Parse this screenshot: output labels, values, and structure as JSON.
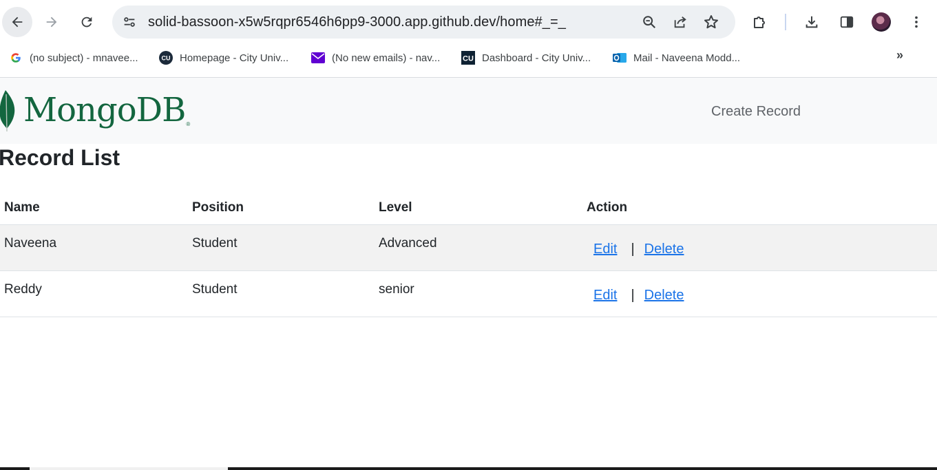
{
  "browser": {
    "url": "solid-bassoon-x5w5rqpr6546h6pp9-3000.app.github.dev/home#_=_",
    "more_bookmarks": "»"
  },
  "bookmarks": [
    {
      "label": "(no subject) - mnavee...",
      "icon": "google-icon"
    },
    {
      "label": "Homepage - City Univ...",
      "icon": "cu-icon"
    },
    {
      "label": "(No new emails) - nav...",
      "icon": "mail-icon"
    },
    {
      "label": "Dashboard - City Univ...",
      "icon": "cu-square-icon"
    },
    {
      "label": "Mail - Naveena Modd...",
      "icon": "outlook-icon"
    }
  ],
  "app": {
    "logo_text": "MongoDB",
    "logo_reg": "®",
    "create_link": "Create Record",
    "title": "Record List"
  },
  "table": {
    "headers": [
      "Name",
      "Position",
      "Level",
      "Action"
    ],
    "rows": [
      {
        "name": "Naveena",
        "position": "Student",
        "level": "Advanced",
        "edit": "Edit",
        "sep": "|",
        "delete": "Delete"
      },
      {
        "name": "Reddy",
        "position": "Student",
        "level": "senior",
        "edit": "Edit",
        "sep": "|",
        "delete": "Delete"
      }
    ]
  },
  "colors": {
    "brand_green": "#13663f",
    "link_blue": "#1a73e8",
    "navbar_bg": "#f8f9fa",
    "striped_row": "#f2f2f2"
  }
}
